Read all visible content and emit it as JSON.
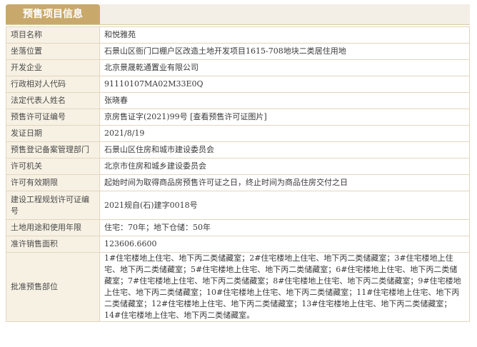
{
  "header": {
    "tab_label": "预售项目信息"
  },
  "rows": [
    {
      "label": "项目名称",
      "value": "和悦雅苑"
    },
    {
      "label": "坐落位置",
      "value": "石景山区衙门口棚户区改造土地开发项目1615-708地块二类居住用地"
    },
    {
      "label": "开发企业",
      "value": "北京景晟乾通置业有限公司"
    },
    {
      "label": "行政相对人代码",
      "value": "91110107MA02M33E0Q"
    },
    {
      "label": "法定代表人姓名",
      "value": "张晓春"
    },
    {
      "label": "预售许可证编号",
      "value": "京房售证字(2021)99号 [查看预售许可证图片]"
    },
    {
      "label": "发证日期",
      "value": "2021/8/19"
    },
    {
      "label": "预售登记备案管理部门",
      "value": "石景山区住房和城市建设委员会"
    },
    {
      "label": "许可机关",
      "value": "北京市住房和城乡建设委员会"
    },
    {
      "label": "许可有效期限",
      "value": "起始时间为取得商品房预售许可证之日，终止时间为商品住房交付之日"
    },
    {
      "label": "建设工程规划许可证编号",
      "value": "2021规自(石)建字0018号"
    },
    {
      "label": "土地用途和使用年限",
      "value": "住宅：70年；地下仓储：50年"
    },
    {
      "label": "准许销售面积",
      "value": "123606.6600"
    },
    {
      "label": "批准预售部位",
      "value": "1#住宅楼地上住宅、地下丙二类储藏室；2#住宅楼地上住宅、地下丙二类储藏室；3#住宅楼地上住宅、地下丙二类储藏室；5#住宅楼地上住宅、地下丙二类储藏室；6#住宅楼地上住宅、地下丙二类储藏室；7#住宅楼地上住宅、地下丙二类储藏室；8#住宅楼地上住宅、地下丙二类储藏室；9#住宅楼地上住宅、地下丙二类储藏室；10#住宅楼地上住宅、地下丙二类储藏室；11#住宅楼地上住宅、地下丙二类储藏室；12#住宅楼地上住宅、地下丙二类储藏室；13#住宅楼地上住宅、地下丙二类储藏室；14#住宅楼地上住宅、地下丙二类储藏室。"
    }
  ]
}
